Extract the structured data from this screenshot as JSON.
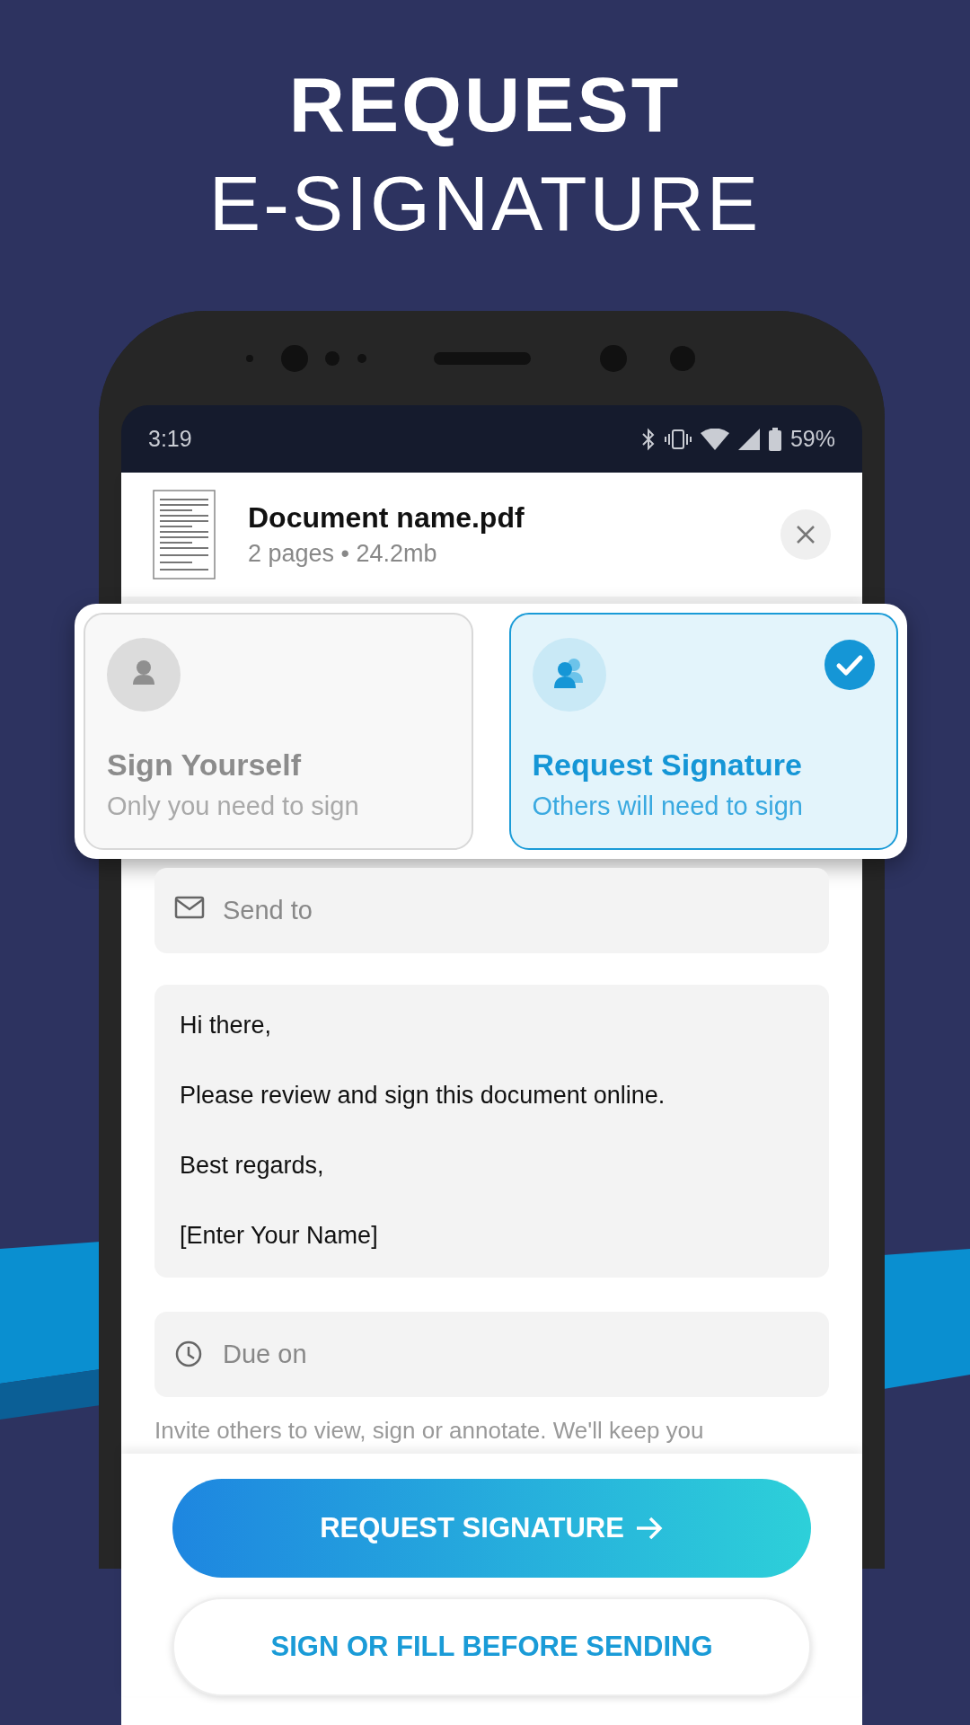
{
  "headline": {
    "line_1": "REQUEST",
    "line_2": "E-SIGNATURE"
  },
  "status_bar": {
    "time": "3:19",
    "battery": "59%"
  },
  "document": {
    "name": "Document name.pdf",
    "details": "2 pages • 24.2mb"
  },
  "options": [
    {
      "kind": "single",
      "title": "Sign Yourself",
      "subtitle": "Only you need to sign",
      "selected": false
    },
    {
      "kind": "group",
      "title": "Request Signature",
      "subtitle": "Others will need to sign",
      "selected": true
    }
  ],
  "form": {
    "send_to": {
      "placeholder": "Send to"
    },
    "message": [
      "Hi there,",
      "Please review and sign this document online.",
      "Best regards,",
      "[Enter Your Name]"
    ],
    "due_on": {
      "placeholder": "Due on"
    },
    "hint": "Invite others to view, sign or annotate. We'll keep you"
  },
  "buttons": [
    {
      "kind": "primary",
      "label": "REQUEST SIGNATURE"
    },
    {
      "kind": "secondary",
      "label": "SIGN OR FILL BEFORE SENDING"
    }
  ]
}
